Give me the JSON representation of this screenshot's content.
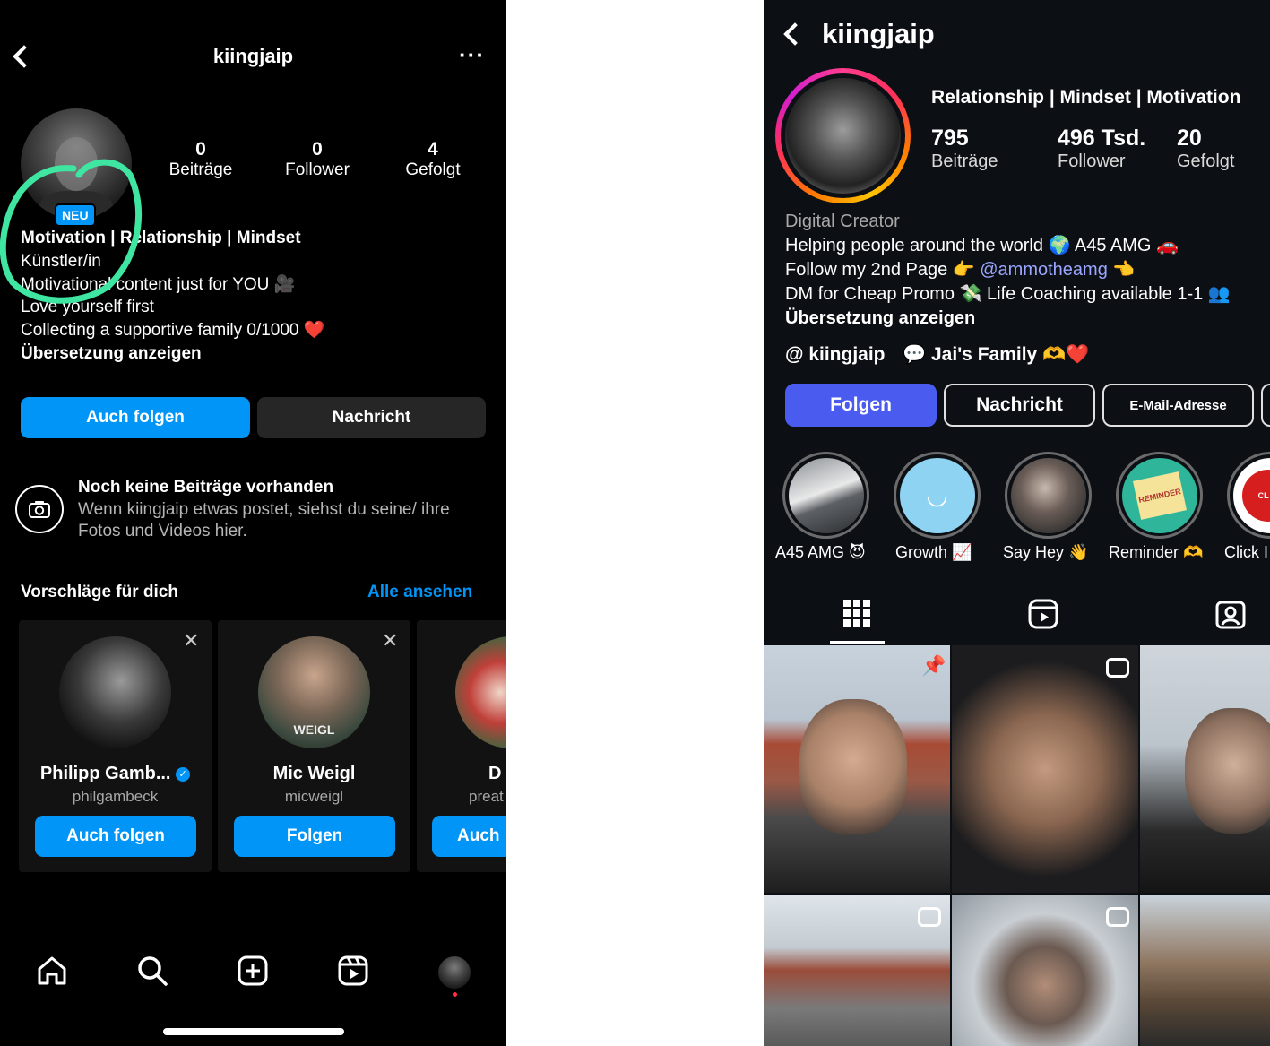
{
  "left": {
    "username": "kiingjaip",
    "more": "···",
    "neu_badge": "NEU",
    "stats": [
      {
        "value": "0",
        "label": "Beiträge"
      },
      {
        "value": "0",
        "label": "Follower"
      },
      {
        "value": "4",
        "label": "Gefolgt"
      }
    ],
    "bio_name": "Motivation | Relationship | Mindset",
    "category": "Künstler/in",
    "bio_lines": [
      "Motivational content just for YOU 🎥",
      "Love yourself first",
      "Collecting a supportive family 0/1000 ❤️"
    ],
    "translate": "Übersetzung anzeigen",
    "follow_back": "Auch folgen",
    "message": "Nachricht",
    "no_posts_title": "Noch keine Beiträge vorhanden",
    "no_posts_text": "Wenn kiingjaip etwas postet, siehst du seine/ ihre Fotos und Videos hier.",
    "suggestions_title": "Vorschläge für dich",
    "see_all": "Alle ansehen",
    "suggestions": [
      {
        "name": "Philipp Gamb...",
        "user": "philgambeck",
        "button": "Auch folgen"
      },
      {
        "name": "Mic Weigl",
        "user": "micweigl",
        "button": "Folgen",
        "shirt": "WEIGL"
      },
      {
        "name": "D",
        "user": "preat",
        "button": "Auch"
      }
    ]
  },
  "right": {
    "username": "kiingjaip",
    "headline": "Relationship | Mindset | Motivation",
    "stats": [
      {
        "value": "795",
        "label": "Beiträge"
      },
      {
        "value": "496 Tsd.",
        "label": "Follower"
      },
      {
        "value": "20",
        "label": "Gefolgt"
      }
    ],
    "category": "Digital Creator",
    "bio_lines": [
      "Helping people around the world 🌍 A45 AMG 🚗",
      "Follow my 2nd Page 👉",
      "DM for Cheap Promo 💸 Life Coaching available 1-1 👥"
    ],
    "mention": "@ammotheamg",
    "mention_suffix": "👈",
    "translate": "Übersetzung anzeigen",
    "threads": "kiingjaip",
    "channel": "Jai's Family 🫶❤️",
    "follow": "Folgen",
    "message": "Nachricht",
    "email": "E-Mail-Adresse",
    "highlights": [
      {
        "label": "A45 AMG 😈"
      },
      {
        "label": "Growth 📈"
      },
      {
        "label": "Say Hey 👋"
      },
      {
        "label": "Reminder 🫶",
        "sticker": "REMINDER"
      },
      {
        "label": "Click I",
        "sticker": "CL M"
      }
    ],
    "accent": "#4a5cf0"
  },
  "colors": {
    "ig_blue": "#0095f6",
    "annotation_green": "#3ee6a1"
  }
}
